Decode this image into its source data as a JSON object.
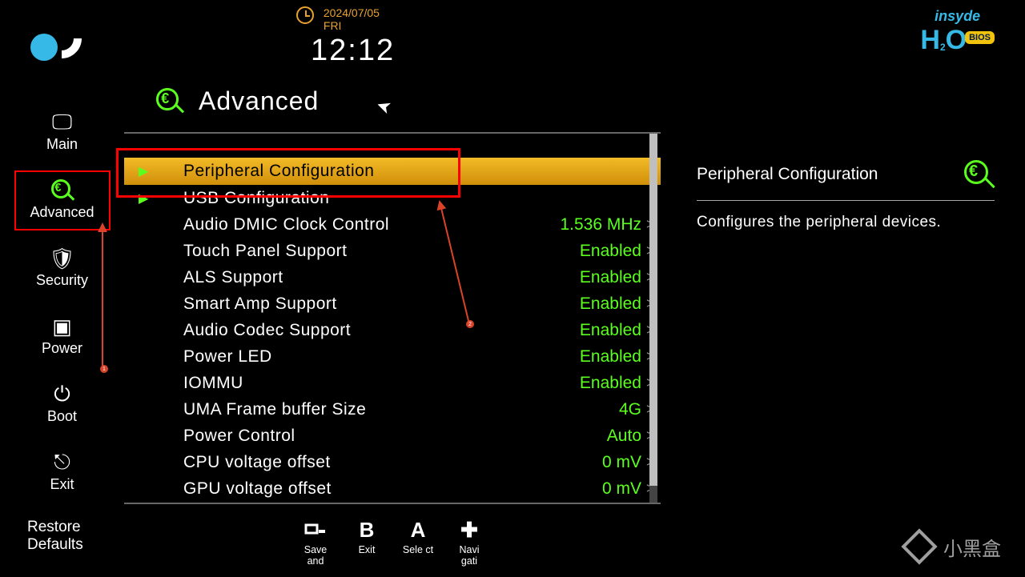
{
  "header": {
    "date": "2024/07/05",
    "day": "FRI",
    "time": "12:12",
    "vendor_line1": "insyde",
    "vendor_h": "H",
    "vendor_sub": "2",
    "vendor_o": "O",
    "vendor_bios": "BIOS"
  },
  "sidebar": {
    "items": [
      {
        "label": "Main",
        "icon": "🖵"
      },
      {
        "label": "Advanced",
        "icon": "mag"
      },
      {
        "label": "Security",
        "icon": "🛡"
      },
      {
        "label": "Power",
        "icon": "▣"
      },
      {
        "label": "Boot",
        "icon": "⏻"
      },
      {
        "label": "Exit",
        "icon": "⎆"
      }
    ],
    "restore": "Restore\nDefaults"
  },
  "page": {
    "title": "Advanced"
  },
  "rows": [
    {
      "arrow": "▶",
      "label": "Peripheral Configuration",
      "value": "",
      "caret": "",
      "selected": true
    },
    {
      "arrow": "▶",
      "label": "USB Configuration",
      "value": "",
      "caret": "",
      "selected": false
    },
    {
      "arrow": "",
      "label": "Audio DMIC Clock Control",
      "value": "1.536 MHz",
      "caret": ">",
      "selected": false
    },
    {
      "arrow": "",
      "label": "Touch Panel Support",
      "value": "Enabled",
      "caret": ">",
      "selected": false
    },
    {
      "arrow": "",
      "label": "ALS Support",
      "value": "Enabled",
      "caret": ">",
      "selected": false
    },
    {
      "arrow": "",
      "label": "Smart Amp Support",
      "value": "Enabled",
      "caret": ">",
      "selected": false
    },
    {
      "arrow": "",
      "label": "Audio Codec Support",
      "value": "Enabled",
      "caret": ">",
      "selected": false
    },
    {
      "arrow": "",
      "label": "Power LED",
      "value": "Enabled",
      "caret": ">",
      "selected": false
    },
    {
      "arrow": "",
      "label": "IOMMU",
      "value": "Enabled",
      "caret": ">",
      "selected": false
    },
    {
      "arrow": "",
      "label": "UMA Frame buffer Size",
      "value": "4G",
      "caret": ">",
      "selected": false
    },
    {
      "arrow": "",
      "label": "Power Control",
      "value": "Auto",
      "caret": ">",
      "selected": false
    },
    {
      "arrow": "",
      "label": "CPU voltage offset",
      "value": "0 mV",
      "caret": ">",
      "selected": false
    },
    {
      "arrow": "",
      "label": "GPU voltage offset",
      "value": "0 mV",
      "caret": ">",
      "selected": false
    }
  ],
  "help": {
    "title": "Peripheral Configuration",
    "body": "Configures the peripheral devices."
  },
  "footer": {
    "keys": [
      {
        "glyph": "⏎",
        "label": "Save and"
      },
      {
        "glyph": "B",
        "label": "Exit"
      },
      {
        "glyph": "A",
        "label": "Sele ct"
      },
      {
        "glyph": "✚",
        "label": "Navi gati"
      }
    ]
  },
  "annotations": {
    "badge1": "1",
    "badge2": "2"
  },
  "watermark": "小黑盒"
}
